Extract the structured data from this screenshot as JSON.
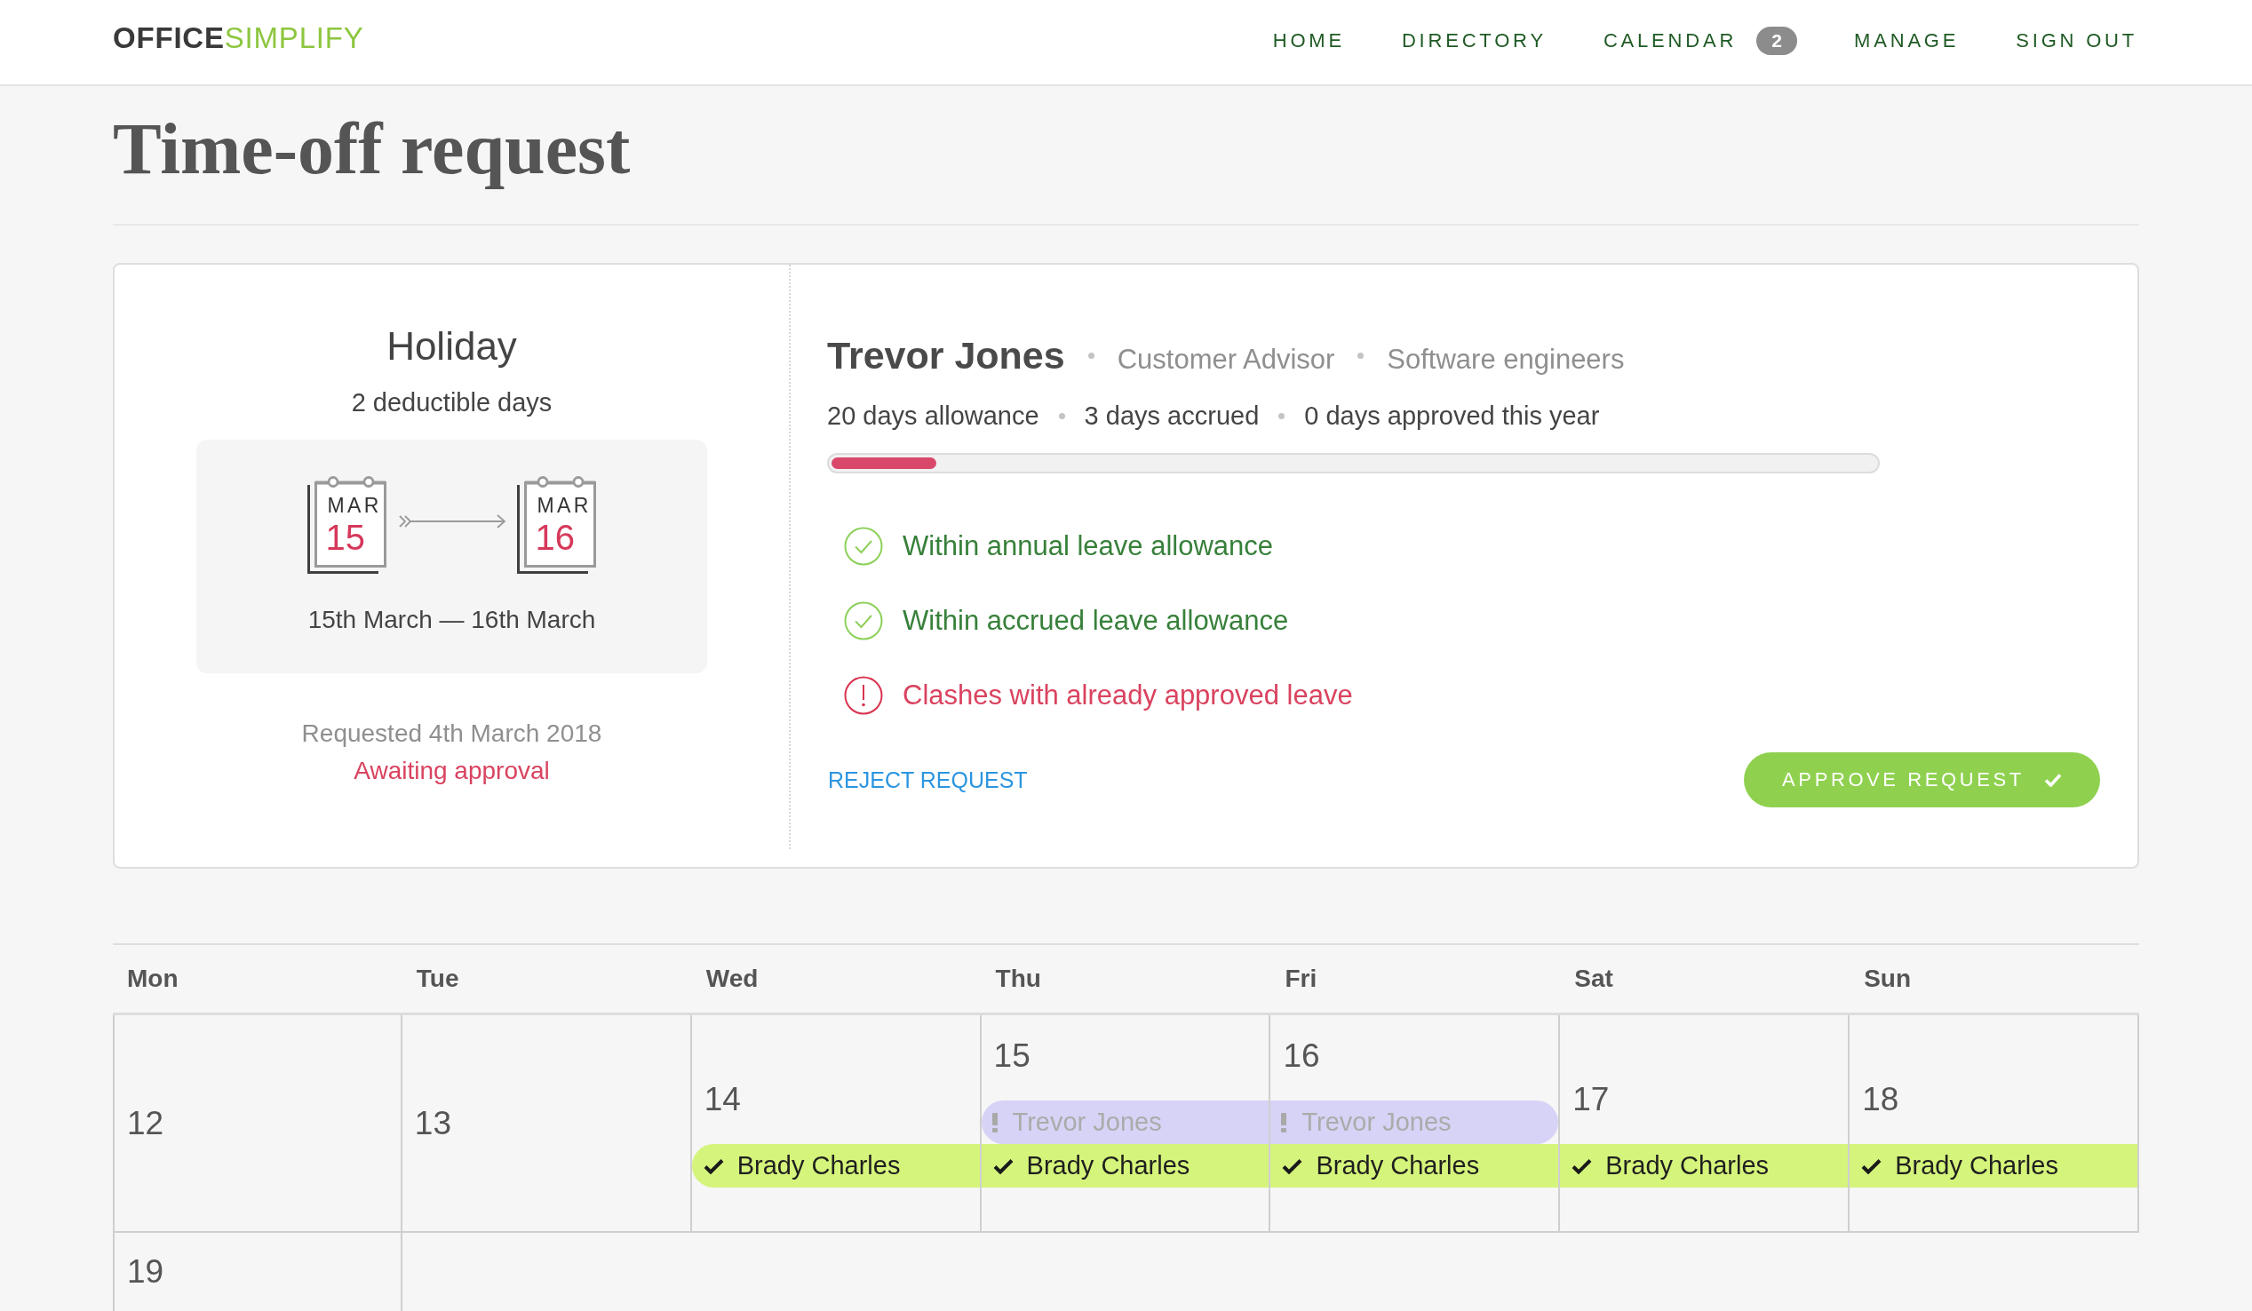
{
  "header": {
    "logo": {
      "lead": "OFFICE",
      "tail": "SIMPLIFY"
    },
    "nav": [
      {
        "label": "HOME"
      },
      {
        "label": "DIRECTORY"
      },
      {
        "label": "CALENDAR",
        "badge": "2"
      },
      {
        "label": "MANAGE"
      },
      {
        "label": "SIGN OUT"
      }
    ]
  },
  "page": {
    "title": "Time-off request"
  },
  "request": {
    "type": "Holiday",
    "deductible": "2 deductible days",
    "dates": [
      {
        "month": "MAR",
        "day": "15"
      },
      {
        "month": "MAR",
        "day": "16"
      }
    ],
    "range": "15th March — 16th March",
    "requested": "Requested 4th March 2018",
    "status": "Awaiting approval"
  },
  "employee": {
    "name": "Trevor Jones",
    "details": [
      "Customer Advisor",
      "Software engineers"
    ],
    "stats": [
      "20 days allowance",
      "3 days accrued",
      "0 days approved this year"
    ],
    "allowance_bar": {
      "level": 0.1
    }
  },
  "checks": [
    {
      "kind": "ok",
      "text": "Within annual leave allowance"
    },
    {
      "kind": "ok",
      "text": "Within accrued leave allowance"
    },
    {
      "kind": "clash",
      "text": "Clashes with already approved leave"
    }
  ],
  "actions": {
    "reject": "REJECT REQUEST",
    "approve": "APPROVE REQUEST"
  },
  "calendar": {
    "weekdays": [
      "Mon",
      "Tue",
      "Wed",
      "Thu",
      "Fri",
      "Sat",
      "Sun"
    ],
    "weeks": [
      {
        "days": [
          {
            "day": "12"
          },
          {
            "day": "13"
          },
          {
            "day": "14",
            "events": [
              {
                "kind": "approved",
                "name": "Brady Charles",
                "first": true,
                "last": false
              }
            ]
          },
          {
            "day": "15",
            "events": [
              {
                "kind": "pending",
                "name": "Trevor Jones",
                "first": true,
                "last": false
              },
              {
                "kind": "approved",
                "name": "Brady Charles",
                "first": false,
                "last": false
              }
            ]
          },
          {
            "day": "16",
            "events": [
              {
                "kind": "pending",
                "name": "Trevor Jones",
                "first": false,
                "last": true
              },
              {
                "kind": "approved",
                "name": "Brady Charles",
                "first": false,
                "last": false
              }
            ]
          },
          {
            "day": "17",
            "events": [
              {
                "kind": "approved",
                "name": "Brady Charles",
                "first": false,
                "last": false
              }
            ]
          },
          {
            "day": "18",
            "events": [
              {
                "kind": "approved",
                "name": "Brady Charles",
                "first": false,
                "last": false
              }
            ]
          }
        ]
      },
      {
        "days": [
          {
            "day": "19"
          }
        ]
      }
    ]
  }
}
